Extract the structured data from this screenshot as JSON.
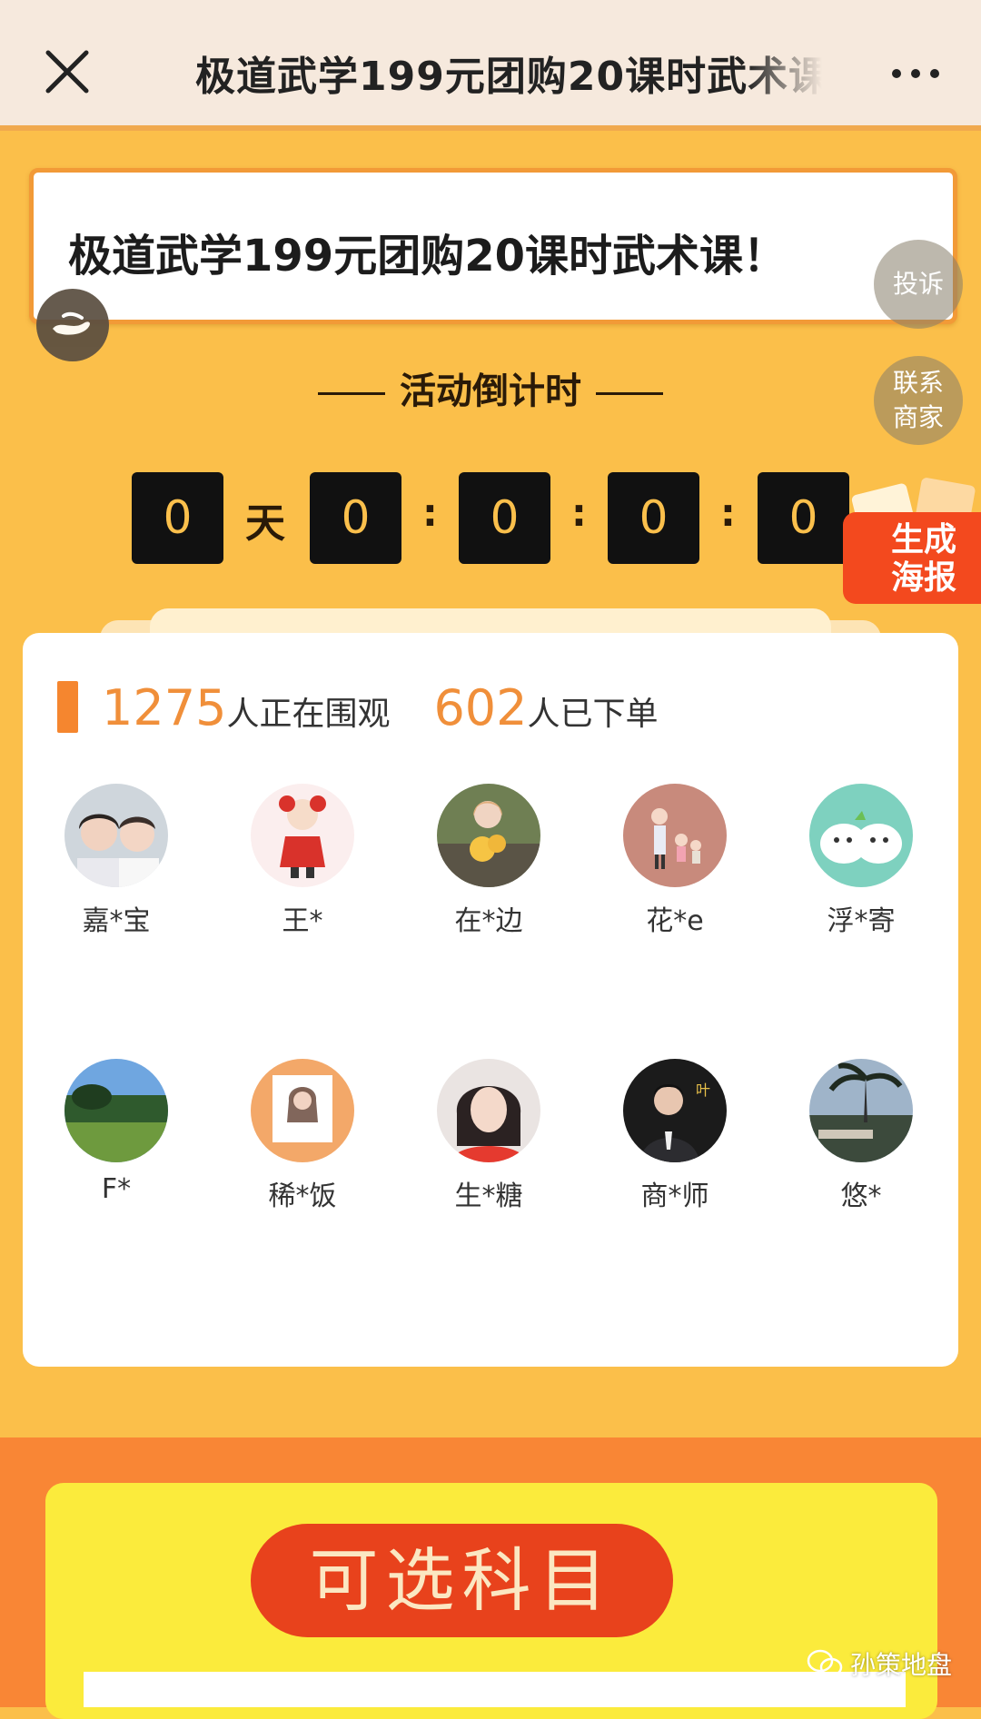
{
  "nav": {
    "title": "极道武学199元团购20课时武术课！"
  },
  "banner": {
    "title": "极道武学199元团购20课时武术课！"
  },
  "float_buttons": {
    "complain": "投诉",
    "contact_line1": "联系",
    "contact_line2": "商家"
  },
  "countdown": {
    "title": "活动倒计时",
    "days": "0",
    "day_unit": "天",
    "hours": "0",
    "minutes": "0",
    "seconds": "0",
    "ms": "0",
    "separator": ":"
  },
  "poster": {
    "label_line1": "生成",
    "label_line2": "海报"
  },
  "stats": {
    "viewers": "1275",
    "viewers_label": "人正在围观",
    "orders": "602",
    "orders_label": "人已下单"
  },
  "participants": [
    {
      "name": "嘉*宝"
    },
    {
      "name": "王*"
    },
    {
      "name": "在*边"
    },
    {
      "name": "花*e"
    },
    {
      "name": "浮*寄"
    },
    {
      "name": "F*"
    },
    {
      "name": "稀*饭"
    },
    {
      "name": "生*糖"
    },
    {
      "name": "商*师"
    },
    {
      "name": "悠*"
    }
  ],
  "subjects": {
    "title": "可选科目"
  },
  "watermark": {
    "text": "孙策地盘"
  },
  "colors": {
    "page_bg": "#fbbf4a",
    "accent_orange": "#f08f3a",
    "countdown_box": "#111111",
    "countdown_digit": "#fbc04c",
    "poster_red": "#f3491e",
    "subjects_pill": "#e8421c",
    "subjects_panel": "#fbeb3c"
  }
}
